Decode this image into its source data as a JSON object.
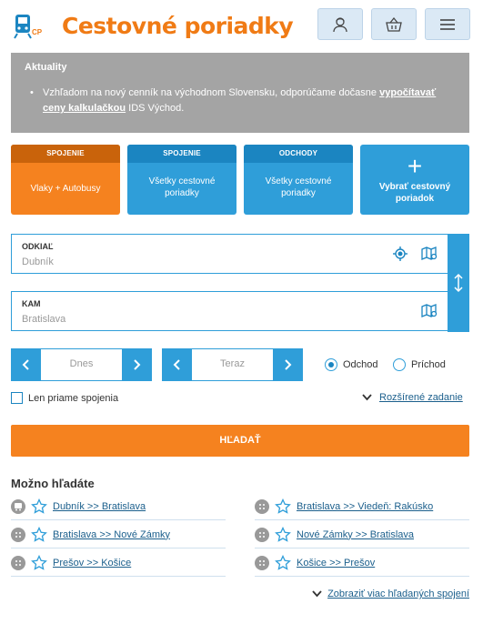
{
  "header": {
    "logo_badge": "CP",
    "title": "Cestovné poriadky",
    "buttons": [
      {
        "icon": "user-icon"
      },
      {
        "icon": "basket-icon"
      },
      {
        "icon": "hamburger-menu-icon"
      }
    ]
  },
  "news": {
    "title": "Aktuality",
    "text_before": "Vzhľadom na nový cenník na východnom Slovensku, odporúčame dočasne ",
    "link": "vypočítavať ceny kalkulačkou",
    "text_after": " IDS Východ."
  },
  "tiles": [
    {
      "head": "SPOJENIE",
      "label": "Vlaky + Autobusy",
      "active": true
    },
    {
      "head": "SPOJENIE",
      "label": "Všetky cestovné poriadky"
    },
    {
      "head": "ODCHODY",
      "label": "Všetky cestovné poriadky"
    },
    {
      "head": "",
      "label": "Vybrať cestovný poriadok",
      "icon": "plus-icon"
    }
  ],
  "from": {
    "label": "ODKIAĽ",
    "value": "Dubník"
  },
  "to": {
    "label": "KAM",
    "value": "Bratislava"
  },
  "date": {
    "value": "Dnes"
  },
  "time": {
    "value": "Teraz"
  },
  "radios": {
    "departure": "Odchod",
    "arrival": "Príchod",
    "selected": "departure"
  },
  "direct_only": "Len priame spojenia",
  "advanced": "Rozšírené zadanie",
  "search_button": "HĽADAŤ",
  "suggestions": {
    "title": "Možno hľadáte",
    "items": [
      "Dubník >> Bratislava",
      "Bratislava >> Viedeň: Rakúsko",
      "Bratislava >> Nové Zámky",
      "Nové Zámky >> Bratislava",
      "Prešov >> Košice",
      "Košice >> Prešov"
    ],
    "more": "Zobraziť viac hľadaných spojení"
  },
  "colors": {
    "orange": "#f5821f",
    "blue": "#2f9ed9",
    "dark_blue": "#1b85c1",
    "news_bg": "#a4a4a4"
  }
}
